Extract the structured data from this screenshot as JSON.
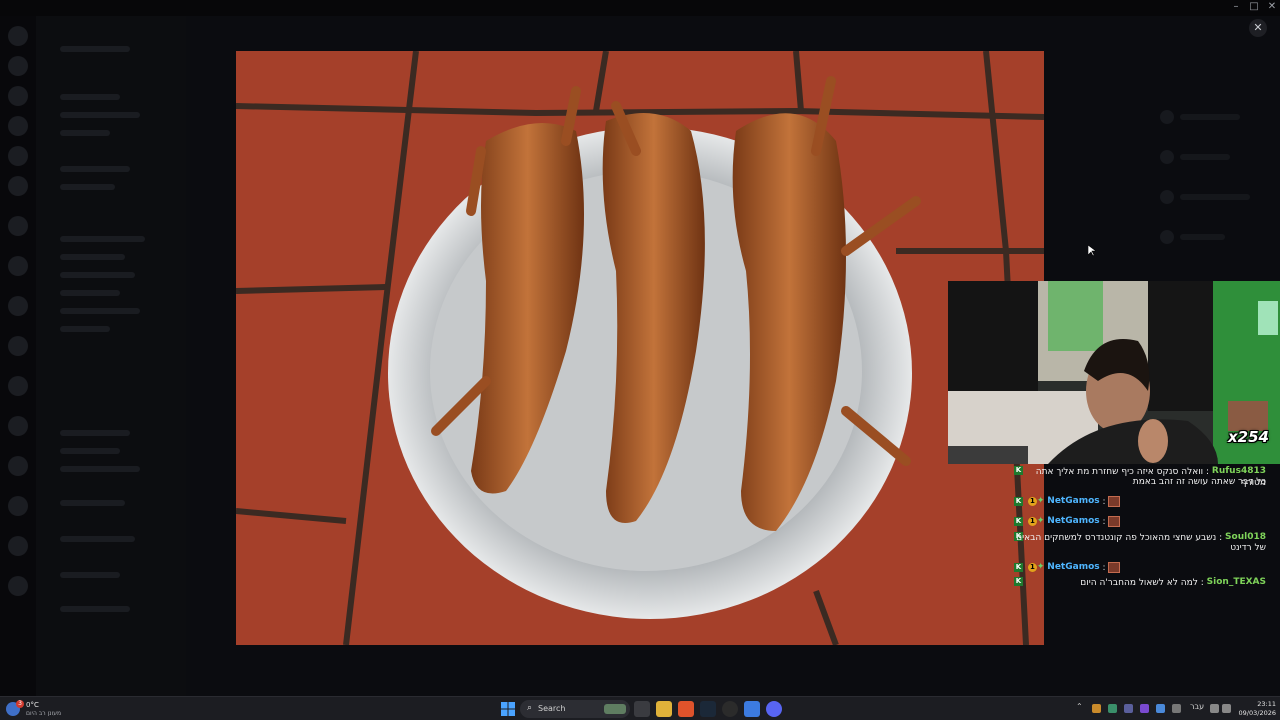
{
  "viewer": {
    "close_icon_label": "✕"
  },
  "stream": {
    "emote_counter": "x254",
    "chat": [
      {
        "user": "Rufus4813",
        "user_color": "#7fd45a",
        "separator": ":",
        "text_line1": "וואלה סנקס איזה כיף שחזרת מת אליך אתה מטורף",
        "text_line2": "כל דבר שאתה עושה זה זהב באמת"
      },
      {
        "user": "NetGamos",
        "user_color": "#4fb6ff",
        "separator": ":",
        "text": ""
      },
      {
        "user": "NetGamos",
        "user_color": "#4fb6ff",
        "separator": ":",
        "text": ""
      },
      {
        "user": "Soul018",
        "user_color": "#7fd45a",
        "separator": ":",
        "text_line1": "נשבע שחצי מהאוכל פה קונטנדרס למשחקים הבאים",
        "text_line2": "של רדינט"
      },
      {
        "user": "NetGamos",
        "user_color": "#4fb6ff",
        "separator": ":",
        "text": ""
      },
      {
        "user": "Sion_TEXAS",
        "user_color": "#7fd45a",
        "separator": ":",
        "text_line1": "למה לא לשאול מהחבר'ה היום"
      }
    ],
    "badge_letter": "K",
    "sub_badge_number": "1"
  },
  "taskbar": {
    "weather_temp": "0°C",
    "weather_badge": "3",
    "weather_condition": "מעונן רב היום",
    "search_label": "Search",
    "tray_lang": "עבר",
    "time": "23:11",
    "date": "09/03/2026"
  },
  "colors": {
    "accent_green": "#1f7a2e",
    "discord_bg": "#0b0c10",
    "taskbar_bg": "#1c1d22"
  }
}
